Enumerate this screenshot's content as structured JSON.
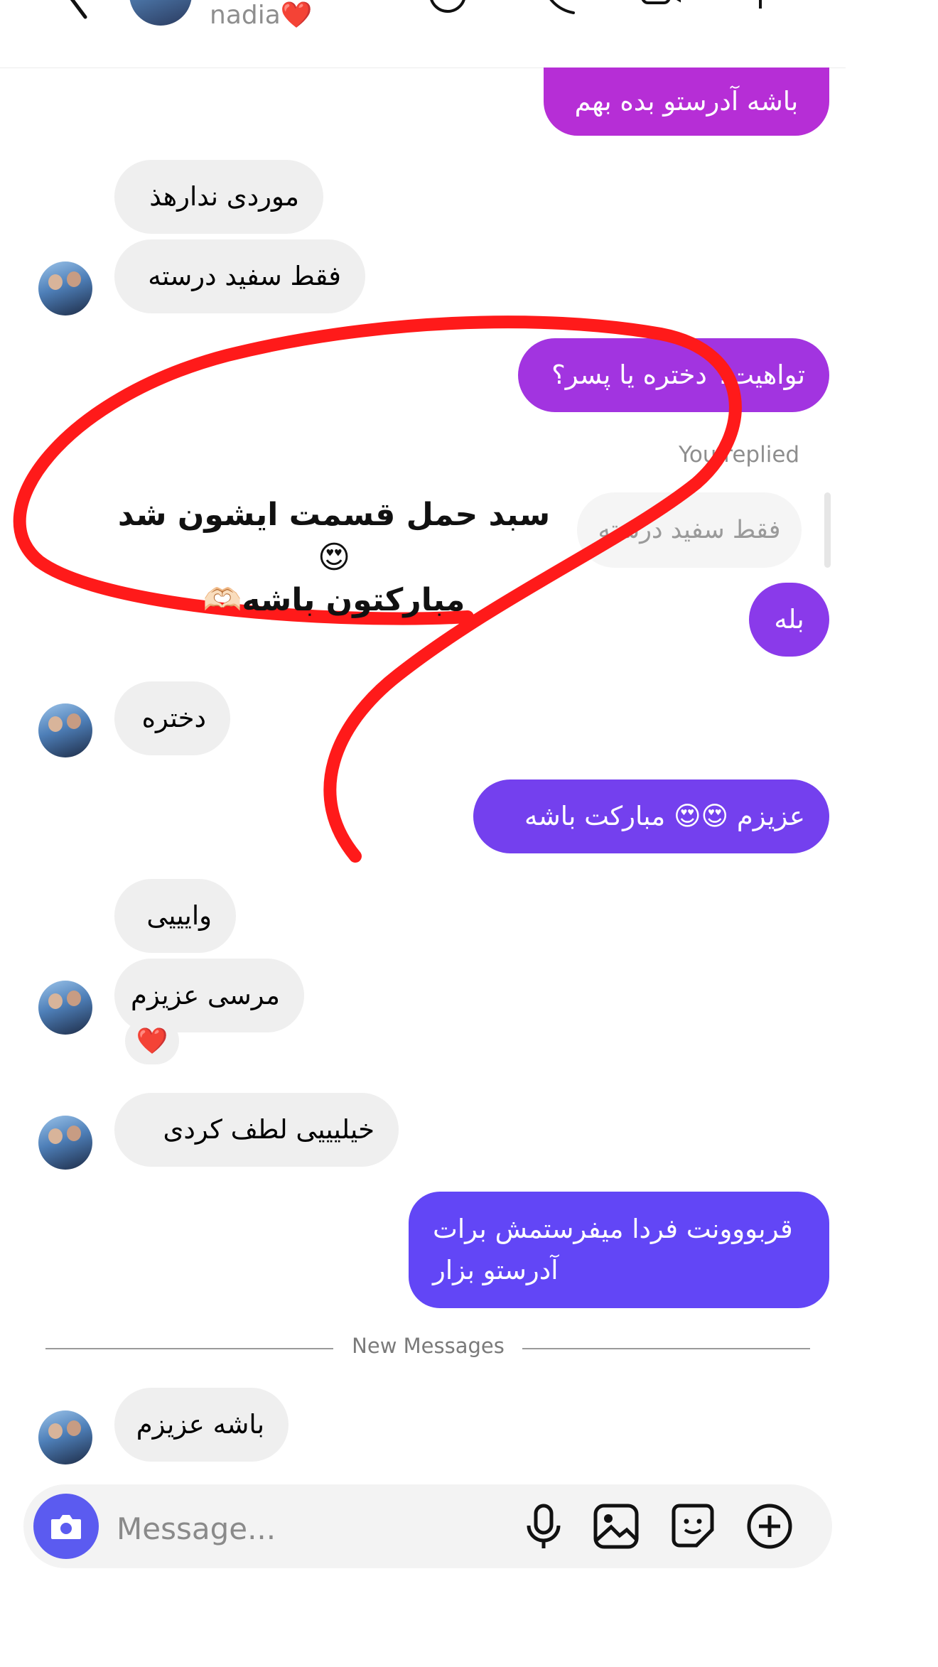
{
  "header": {
    "contact_name": "nadia❤️"
  },
  "messages": [
    {
      "id": "m1",
      "direction": "outgoing",
      "text": "باشه آدرستو بده بهم"
    },
    {
      "id": "m2",
      "direction": "incoming",
      "text": "موردی ندارهذ"
    },
    {
      "id": "m3",
      "direction": "incoming",
      "text": "فقط سفید درسته"
    },
    {
      "id": "m4",
      "direction": "outgoing",
      "text": "تواهیت؟ دختره یا پسر؟"
    },
    {
      "id": "m5",
      "direction": "outgoing",
      "text": "بله",
      "reply_label": "You replied",
      "quoted_text": "فقط سفید درسته"
    },
    {
      "id": "m6",
      "direction": "incoming",
      "text": "دختره"
    },
    {
      "id": "m7",
      "direction": "outgoing",
      "text": "عزیزم 😍😍 مبارکت باشه"
    },
    {
      "id": "m8",
      "direction": "incoming",
      "text": "وایییی"
    },
    {
      "id": "m9",
      "direction": "incoming",
      "text": "مرسی عزیزم",
      "reaction": "❤️"
    },
    {
      "id": "m10",
      "direction": "incoming",
      "text": "خیلیییی لطف کردی"
    },
    {
      "id": "m11",
      "direction": "outgoing",
      "lines": [
        "قربووونت فردا میفرستمش برات",
        "آدرستو بزار"
      ]
    },
    {
      "id": "m12",
      "direction": "incoming",
      "text": "باشه عزیزم"
    }
  ],
  "divider": {
    "label": "New Messages"
  },
  "composer": {
    "placeholder": "Message..."
  },
  "overlay": {
    "lines": [
      "سبد حمل قسمت ایشون شد😍",
      "مبارکتون باشه🫶🏻"
    ],
    "stroke_color": "#ff1a1a"
  },
  "colors": {
    "outgoing_gradient": [
      "#b02fd6",
      "#5e45f5"
    ],
    "camera_button": "#5b5bf0",
    "incoming_bubble": "#efefef"
  },
  "icons": [
    "back-icon",
    "sticker-icon",
    "phone-icon",
    "video-icon",
    "flag-icon",
    "camera-icon",
    "microphone-icon",
    "gallery-icon",
    "sticker-icon",
    "plus-icon"
  ]
}
